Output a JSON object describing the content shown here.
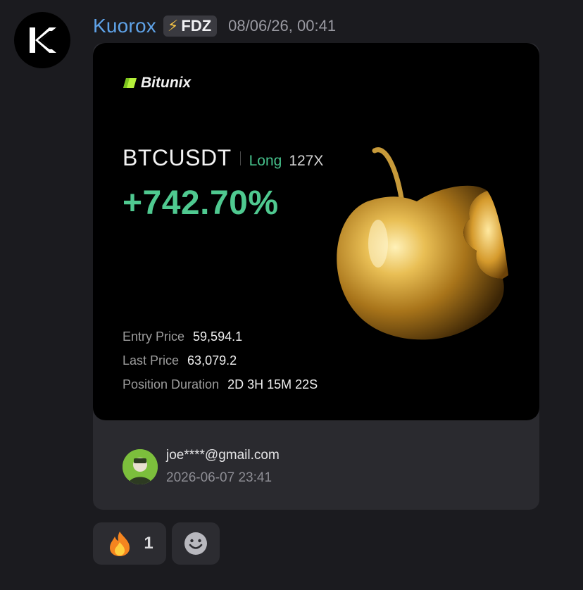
{
  "message": {
    "username": "Kuorox",
    "tag": {
      "icon": "lightning-icon",
      "label": "FDZ"
    },
    "timestamp": "08/06/26, 00:41"
  },
  "card": {
    "brand": "Bitunix",
    "pair": "BTCUSDT",
    "side": "Long",
    "leverage": "127X",
    "pnl": "+742.70%",
    "stats": [
      {
        "label": "Entry Price",
        "value": "59,594.1"
      },
      {
        "label": "Last Price",
        "value": "63,079.2"
      },
      {
        "label": "Position Duration",
        "value": "2D 3H 15M 22S"
      }
    ],
    "colors": {
      "profit": "#4fc990",
      "side": "#46c08b"
    }
  },
  "footer": {
    "email": "joe****@gmail.com",
    "date": "2026-06-07 23:41"
  },
  "reactions": [
    {
      "icon": "fire-emoji-icon",
      "count": "1"
    },
    {
      "icon": "add-reaction-icon"
    }
  ]
}
